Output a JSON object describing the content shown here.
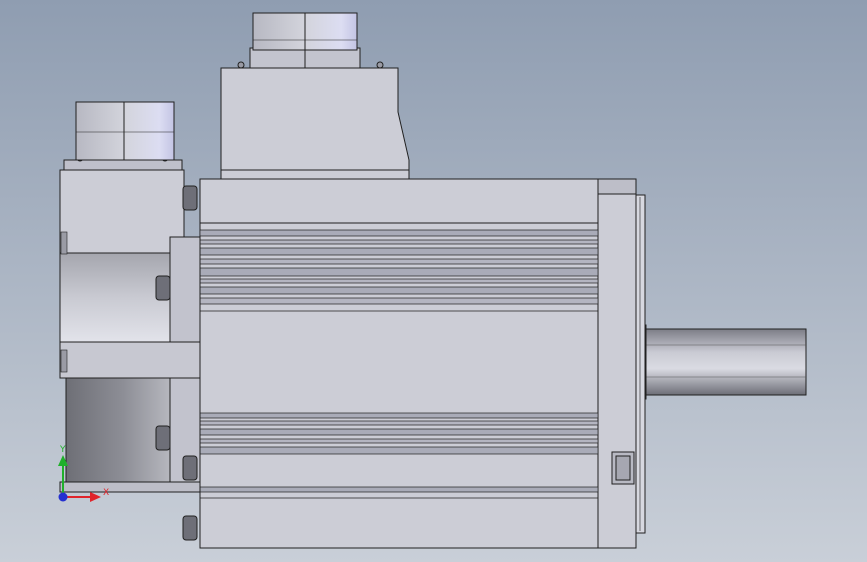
{
  "viewport": {
    "background_top": "#8F9DB1",
    "background_bottom": "#C9CFD8"
  },
  "model": {
    "body_color": "#CCCDD6",
    "edge_color": "#202020",
    "rib_color": "#A9ABB8",
    "shaft_color": "#B9BAC4"
  },
  "triad": {
    "x_label": "X",
    "y_label": "Y",
    "x_color": "#E0242B",
    "y_color": "#1FB02A",
    "z_color": "#2430D0"
  }
}
